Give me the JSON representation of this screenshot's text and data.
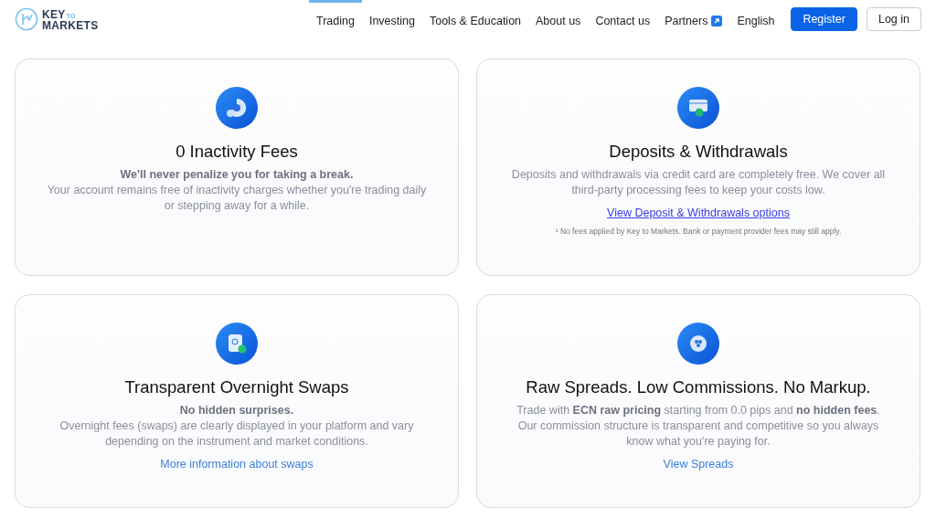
{
  "header": {
    "logo": {
      "word_top": "KEY",
      "word_small": "TO",
      "word_bottom": "MARKETS"
    },
    "nav": [
      {
        "label": "Trading",
        "selected": true,
        "external": false
      },
      {
        "label": "Investing",
        "selected": false,
        "external": false
      },
      {
        "label": "Tools & Education",
        "selected": false,
        "external": false
      },
      {
        "label": "About us",
        "selected": false,
        "external": false
      },
      {
        "label": "Contact us",
        "selected": false,
        "external": false
      },
      {
        "label": "Partners",
        "selected": false,
        "external": true
      },
      {
        "label": "English",
        "selected": false,
        "external": false
      }
    ],
    "buttons": [
      {
        "label": "Register",
        "kind": "primary"
      },
      {
        "label": "Log in",
        "kind": "outline"
      }
    ]
  },
  "cards": [
    {
      "kind": "chart",
      "title": "0 Inactivity Fees",
      "lead": "We'll never penalize you for taking a break.",
      "body": "Your account remains free of inactivity charges whether you're trading daily or stepping away for a while."
    },
    {
      "kind": "card",
      "title": "Deposits & Withdrawals",
      "body": "Deposits and withdrawals via credit card are completely free. We cover all third-party processing fees to keep your costs low.",
      "link": {
        "label": "View Deposit & Withdrawals options",
        "kind": "underlined"
      },
      "footnote": "¹ No fees applied by Key to Markets. Bank or payment provider fees may still apply."
    },
    {
      "kind": "clock",
      "title": "Transparent Overnight Swaps",
      "lead": "No hidden surprises.",
      "body": "Overnight fees (swaps) are clearly displayed in your platform and vary depending on the instrument and market conditions.",
      "link": {
        "label": "More information about swaps",
        "kind": "plain"
      }
    },
    {
      "kind": "coin",
      "title": "Raw Spreads. Low Commissions. No Markup.",
      "body": "Trade with **ECN raw pricing** starting from 0.0 pips and **no hidden fees**. Our commission structure is transparent and competitive so you always know what you're paying for.",
      "link": {
        "label": "View Spreads",
        "kind": "plain"
      }
    }
  ]
}
